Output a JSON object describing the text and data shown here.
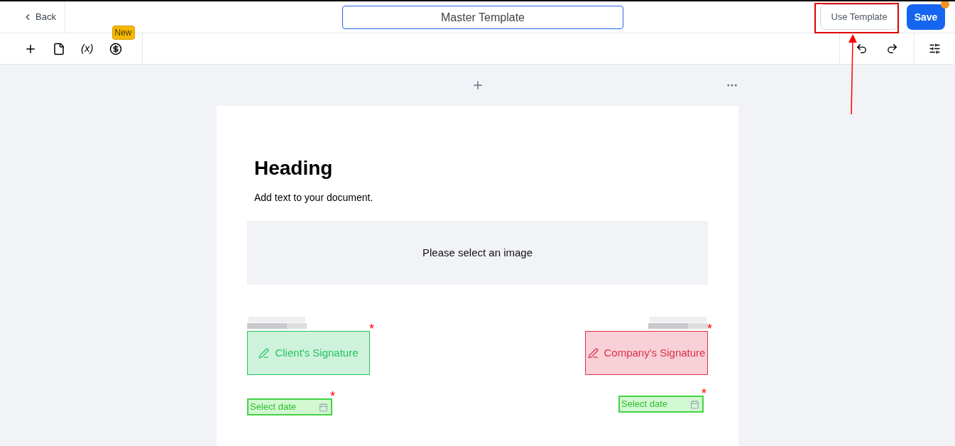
{
  "header": {
    "back": "Back",
    "title": "Master Template",
    "use_template": "Use Template",
    "save": "Save",
    "save_has_notification": true
  },
  "toolbar": {
    "variable": "(x)",
    "new_badge": "New"
  },
  "document": {
    "heading": "Heading",
    "text": "Add text to your document.",
    "image_placeholder": "Please select an image",
    "signers": [
      {
        "signature": "Client's Signature",
        "color": "#22c55e",
        "required_mark": "*",
        "date": {
          "placeholder": "Select date",
          "required_mark": "*"
        }
      },
      {
        "signature": "Company's Signature",
        "color": "#dc2e4a",
        "required_mark": "*",
        "date": {
          "placeholder": "Select date",
          "required_mark": "*"
        }
      }
    ]
  },
  "annotation": {
    "shown": true
  }
}
